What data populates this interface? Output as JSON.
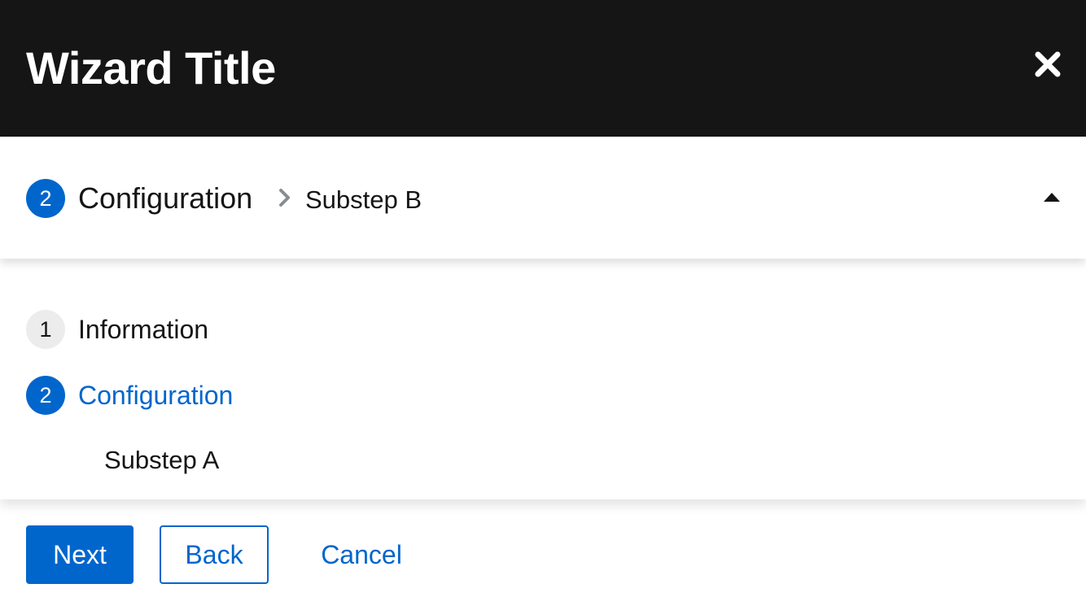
{
  "header": {
    "title": "Wizard Title",
    "close_icon": "close-icon"
  },
  "toggle": {
    "step_number": "2",
    "step_label": "Configuration",
    "separator_icon": "chevron-right-icon",
    "substep_label": "Substep B",
    "caret_icon": "caret-up-icon"
  },
  "nav": {
    "items": [
      {
        "number": "1",
        "label": "Information",
        "current": false
      },
      {
        "number": "2",
        "label": "Configuration",
        "current": true
      }
    ],
    "subitems": [
      {
        "label": "Substep A"
      }
    ]
  },
  "footer": {
    "next_label": "Next",
    "back_label": "Back",
    "cancel_label": "Cancel"
  },
  "colors": {
    "header_bg": "#151515",
    "primary": "#0066cc",
    "step_inactive_bg": "#ececec",
    "text": "#151515"
  }
}
